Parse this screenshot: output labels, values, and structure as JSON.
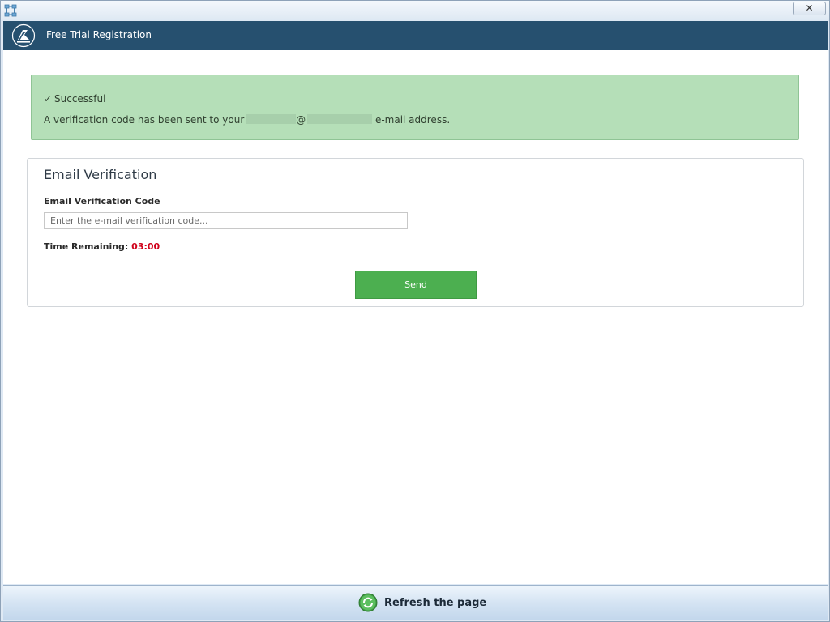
{
  "window": {
    "close_glyph": "✕",
    "sys_icon": "app-network-icon"
  },
  "header": {
    "title": "Free Trial Registration",
    "logo_icon": "brand-logo-icon",
    "background": "#26506f"
  },
  "alert": {
    "title": "Successful",
    "check_glyph": "✓",
    "message_prefix": "A verification code has been sent to your",
    "at_sign": "@",
    "message_suffix": "e-mail address.",
    "background": "#b5dfb8"
  },
  "verification": {
    "heading": "Email Verification",
    "code_label": "Email Verification Code",
    "code_placeholder": "Enter the e-mail verification code...",
    "code_value": "",
    "timer_label": "Time Remaining:",
    "timer_value": "03:00",
    "timer_color": "#d0021b",
    "send_label": "Send",
    "send_color": "#4caf50"
  },
  "footer": {
    "refresh_label": "Refresh the page",
    "refresh_icon": "refresh-icon"
  }
}
